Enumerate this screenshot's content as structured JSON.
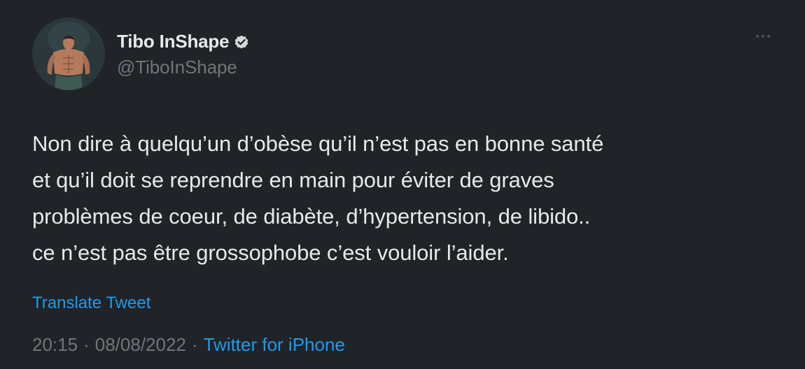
{
  "author": {
    "display_name": "Tibo InShape",
    "handle": "@TiboInShape",
    "verified": true
  },
  "tweet": {
    "lines": [
      "Non dire à quelqu’un d’obèse qu’il n’est pas en bonne santé",
      "et qu’il doit se reprendre en main pour éviter de graves",
      "problèmes de coeur, de diabète, d’hypertension, de libido..",
      "ce n’est pas être grossophobe c’est vouloir l’aider."
    ],
    "translate_label": "Translate Tweet",
    "time": "20:15",
    "date": "08/08/2022",
    "separator": "·",
    "source": "Twitter for iPhone"
  },
  "icons": {
    "verified": "verified-badge-icon",
    "more": "more-horizontal-icon"
  },
  "colors": {
    "background": "#202327",
    "text": "#e7e9ea",
    "secondary": "#71767b",
    "accent": "#1d9bf0"
  }
}
